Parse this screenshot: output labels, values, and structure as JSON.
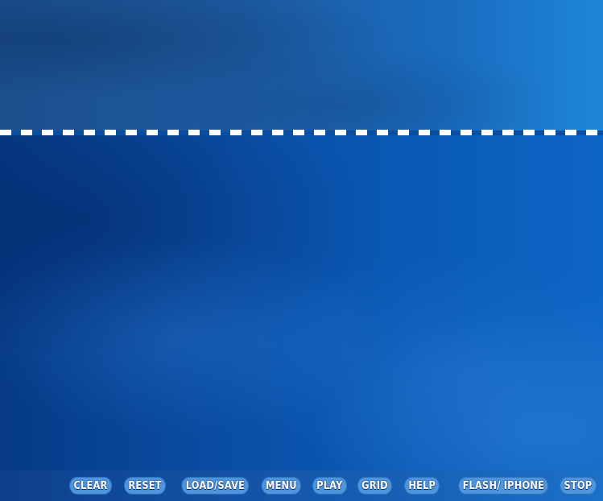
{
  "colors": {
    "background": "#0a4ea0",
    "divider": "#ffffff",
    "button_fill": "#4f95dc",
    "button_text": "#ffffff"
  },
  "toolbar": {
    "buttons": [
      {
        "id": "clear",
        "label": "CLEAR"
      },
      {
        "id": "reset",
        "label": "RESET"
      },
      {
        "id": "load-save",
        "label": "LOAD/SAVE"
      },
      {
        "id": "menu",
        "label": "MENU"
      },
      {
        "id": "play",
        "label": "PLAY"
      },
      {
        "id": "grid",
        "label": "GRID"
      },
      {
        "id": "help",
        "label": "HELP"
      },
      {
        "id": "flash-iphone",
        "label": "FLASH/ IPHONE"
      },
      {
        "id": "stop",
        "label": "STOP"
      }
    ]
  }
}
